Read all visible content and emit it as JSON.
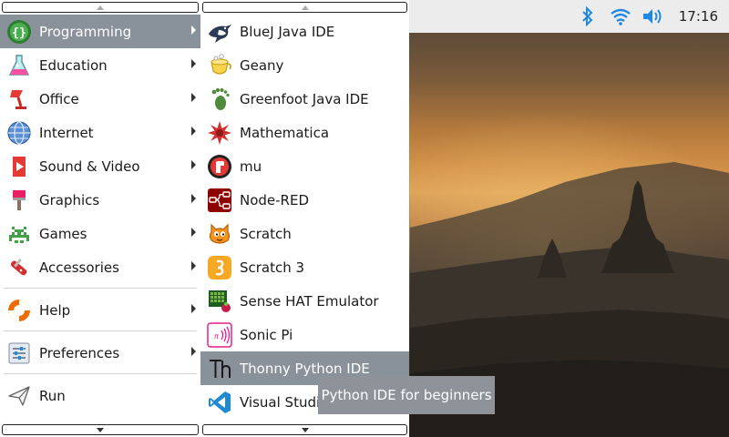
{
  "taskbar": {
    "clock": "17:16",
    "tray_icons": [
      "bluetooth-icon",
      "wifi-icon",
      "volume-icon"
    ],
    "bar_color": "#ececec"
  },
  "main_menu": {
    "items": [
      {
        "label": "Programming",
        "icon": "programming-icon",
        "has_submenu": true,
        "selected": true
      },
      {
        "label": "Education",
        "icon": "education-icon",
        "has_submenu": true
      },
      {
        "label": "Office",
        "icon": "office-icon",
        "has_submenu": true
      },
      {
        "label": "Internet",
        "icon": "internet-icon",
        "has_submenu": true
      },
      {
        "label": "Sound & Video",
        "icon": "sound-video-icon",
        "has_submenu": true
      },
      {
        "label": "Graphics",
        "icon": "graphics-icon",
        "has_submenu": true
      },
      {
        "label": "Games",
        "icon": "games-icon",
        "has_submenu": true
      },
      {
        "label": "Accessories",
        "icon": "accessories-icon",
        "has_submenu": true
      },
      {
        "label": "Help",
        "icon": "help-icon",
        "has_submenu": true
      },
      {
        "label": "Preferences",
        "icon": "preferences-icon",
        "has_submenu": true
      },
      {
        "label": "Run",
        "icon": "run-icon",
        "has_submenu": false
      }
    ],
    "selection_color": "#89929a"
  },
  "programming_submenu": {
    "items": [
      {
        "label": "BlueJ Java IDE",
        "icon": "bluej-icon"
      },
      {
        "label": "Geany",
        "icon": "geany-icon"
      },
      {
        "label": "Greenfoot Java IDE",
        "icon": "greenfoot-icon"
      },
      {
        "label": "Mathematica",
        "icon": "mathematica-icon"
      },
      {
        "label": "mu",
        "icon": "mu-icon"
      },
      {
        "label": "Node-RED",
        "icon": "node-red-icon"
      },
      {
        "label": "Scratch",
        "icon": "scratch-icon"
      },
      {
        "label": "Scratch 3",
        "icon": "scratch3-icon"
      },
      {
        "label": "Sense HAT Emulator",
        "icon": "sense-hat-icon"
      },
      {
        "label": "Sonic Pi",
        "icon": "sonic-pi-icon"
      },
      {
        "label": "Thonny Python IDE",
        "icon": "thonny-icon",
        "selected": true
      },
      {
        "label": "Visual Studio Code",
        "icon": "vscode-icon"
      }
    ]
  },
  "tooltip": {
    "text": "Python IDE for beginners"
  }
}
